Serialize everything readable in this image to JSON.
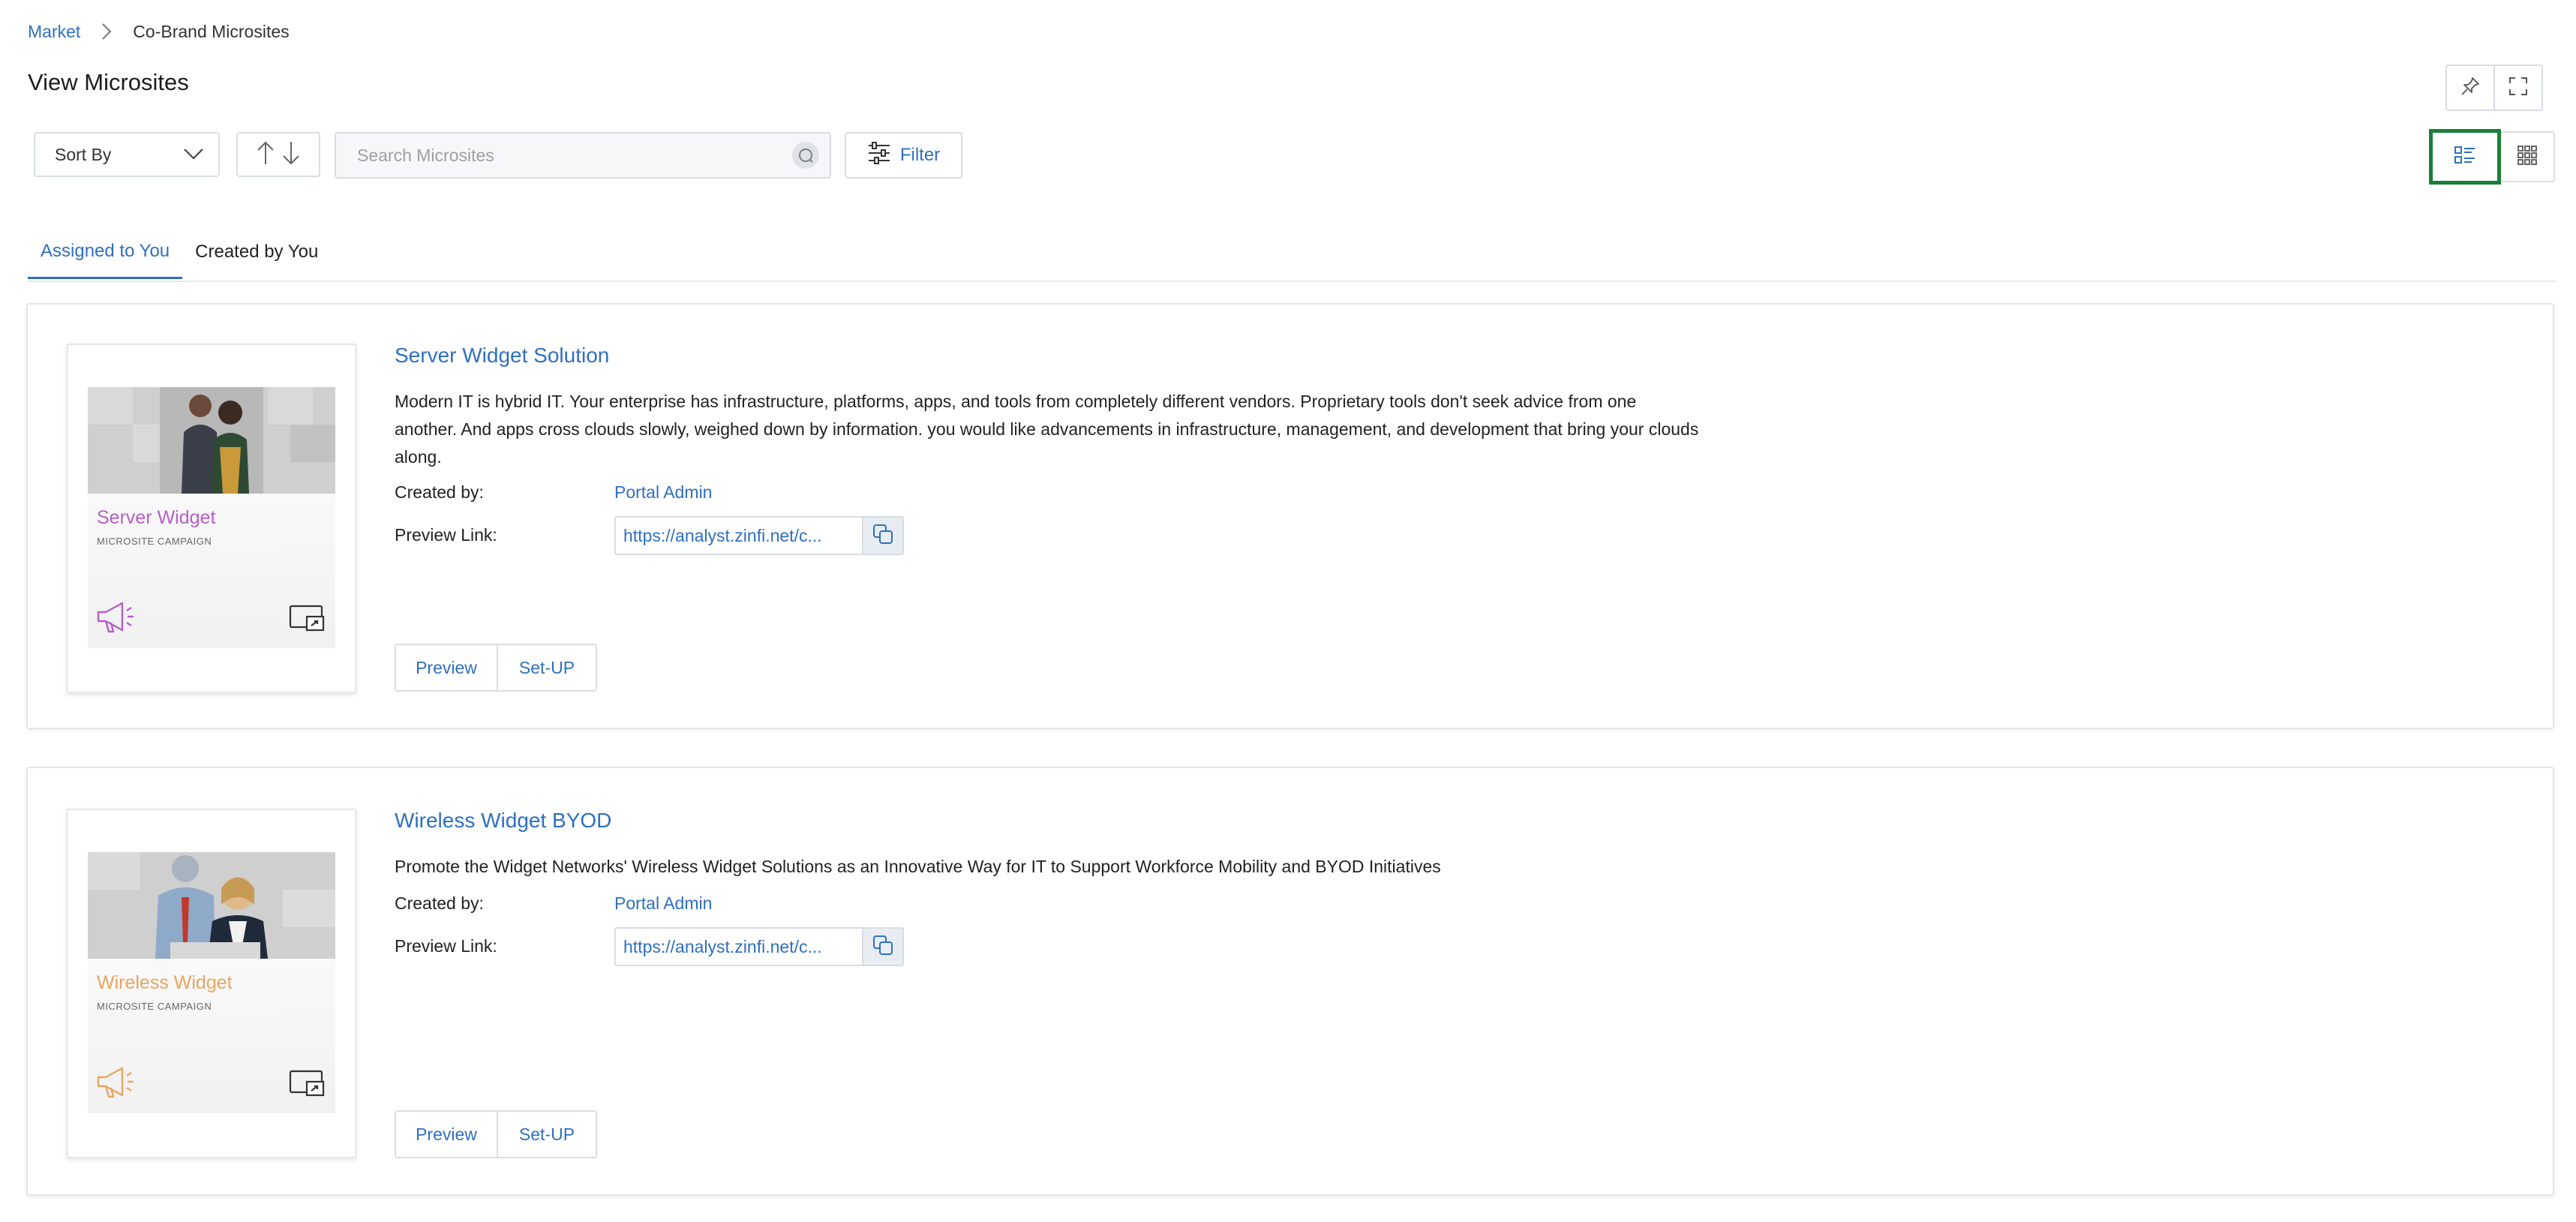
{
  "breadcrumb": {
    "market": "Market",
    "current": "Co-Brand Microsites"
  },
  "page": {
    "title": "View Microsites"
  },
  "toolbar": {
    "sort_label": "Sort By",
    "search_placeholder": "Search Microsites",
    "filter_label": "Filter"
  },
  "tabs": [
    {
      "label": "Assigned to You",
      "active": true
    },
    {
      "label": "Created by You",
      "active": false
    }
  ],
  "labels": {
    "created_by": "Created by:",
    "preview_link": "Preview Link:"
  },
  "microsites": [
    {
      "title": "Server Widget Solution",
      "description": "Modern IT is hybrid IT. Your enterprise has infrastructure, platforms, apps, and tools from completely different vendors. Proprietary tools don't seek advice from one another. And apps cross clouds slowly, weighed down by information. you would like advancements in infrastructure, management, and development that bring your clouds along.",
      "created_by": "Portal Admin",
      "preview_link": "https://analyst.zinfi.net/c...",
      "thumb_title": "Server Widget",
      "thumb_subtitle": "MICROSITE CAMPAIGN",
      "thumb_color": "#b65fc6",
      "preview_label": "Preview",
      "setup_label": "Set-UP"
    },
    {
      "title": "Wireless Widget BYOD",
      "description": "Promote the Widget Networks' Wireless Widget Solutions as an Innovative Way for IT to Support Workforce Mobility and BYOD Initiatives",
      "created_by": "Portal Admin",
      "preview_link": "https://analyst.zinfi.net/c...",
      "thumb_title": "Wireless Widget",
      "thumb_subtitle": "MICROSITE CAMPAIGN",
      "thumb_color": "#e9a561",
      "preview_label": "Preview",
      "setup_label": "Set-UP"
    }
  ],
  "colors": {
    "accent": "#2f6fc0",
    "active_view_outline": "#1a7f37",
    "border": "#d9dde3"
  },
  "icons": [
    "chevron-right-icon",
    "pin-icon",
    "fullscreen-icon",
    "chevron-down-icon",
    "sort-asc-icon",
    "sort-desc-icon",
    "search-icon",
    "filter-sliders-icon",
    "list-view-icon",
    "grid-view-icon",
    "copy-icon",
    "megaphone-icon",
    "screen-share-icon"
  ]
}
